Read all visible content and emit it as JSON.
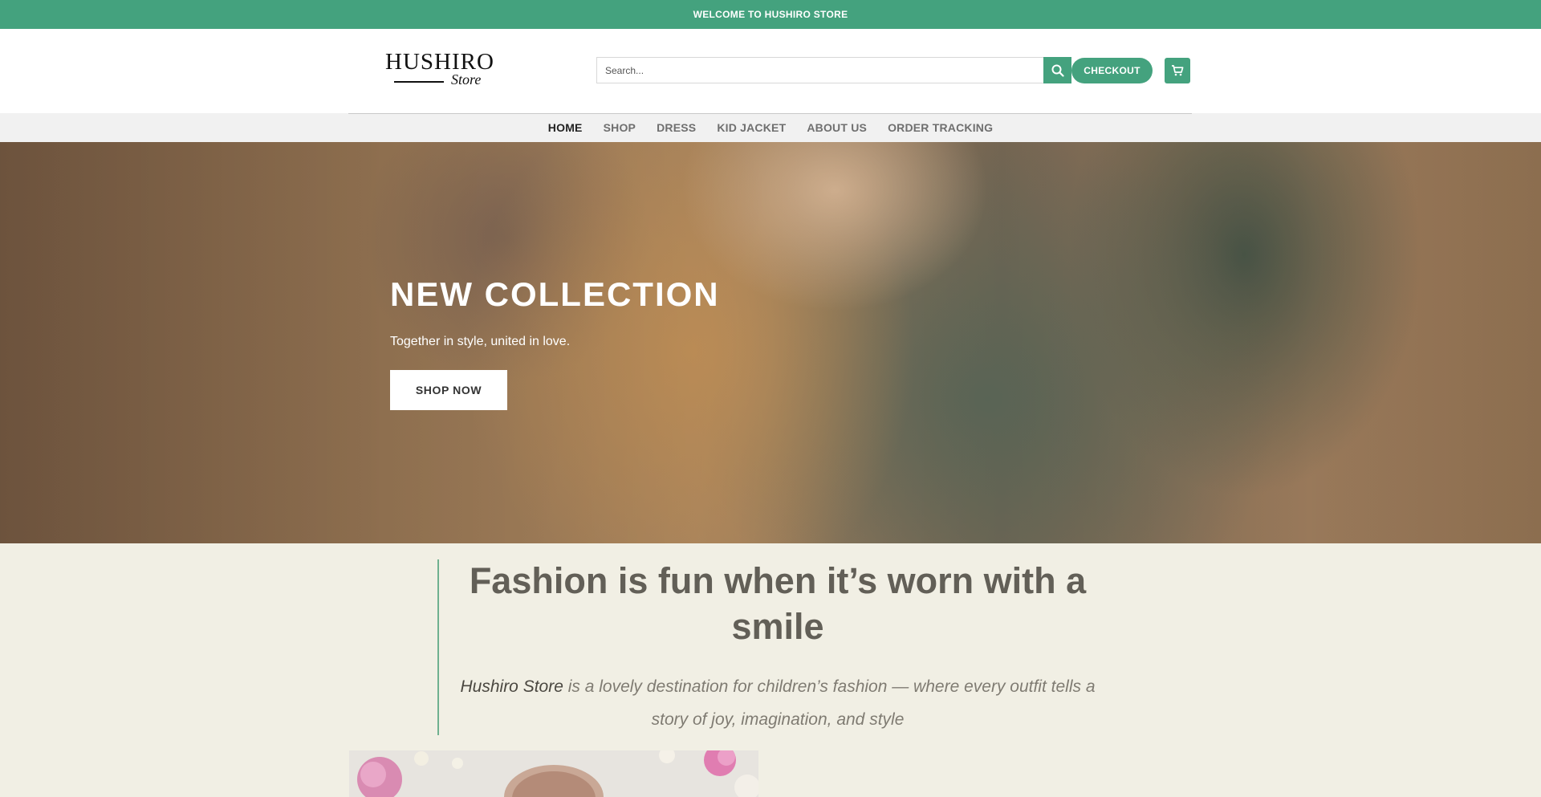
{
  "topbar": {
    "text": "WELCOME TO HUSHIRO STORE",
    "bg": "#44a27e"
  },
  "logo": {
    "brand": "HUSHIRO",
    "sub": "Store"
  },
  "search": {
    "placeholder": "Search...",
    "icon": "search-icon"
  },
  "header_actions": {
    "checkout_label": "CHECKOUT",
    "cart_icon": "cart-icon"
  },
  "nav": {
    "items": [
      {
        "label": "HOME",
        "active": true
      },
      {
        "label": "SHOP"
      },
      {
        "label": "DRESS"
      },
      {
        "label": "KID JACKET"
      },
      {
        "label": "ABOUT US"
      },
      {
        "label": "ORDER TRACKING"
      }
    ]
  },
  "hero": {
    "title": "NEW COLLECTION",
    "subtitle": "Together in style, united in love.",
    "cta": "SHOP NOW"
  },
  "quote": {
    "heading": "Fashion is fun when it’s worn with a smile",
    "lead_store": "Hushiro Store",
    "lead_rest": " is a lovely destination for children’s fashion — where every outfit tells a story of joy, imagination, and style"
  },
  "colors": {
    "accent": "#44a27e",
    "section_bg": "#f1efe4"
  }
}
